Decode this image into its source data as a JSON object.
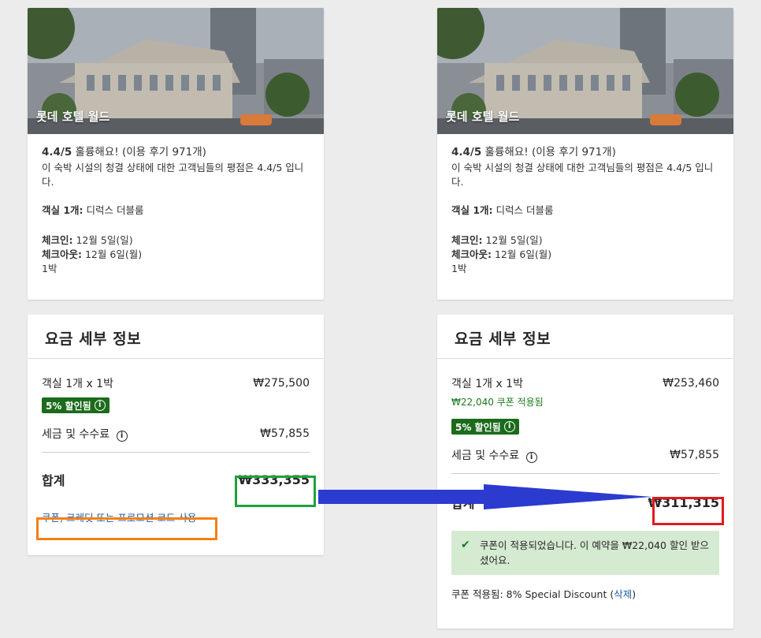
{
  "left": {
    "hotel": {
      "name": "롯데 호텔 월드",
      "rating_score": "4.4/5",
      "rating_word": "훌륭해요!",
      "review_count": "(이용 후기 971개)",
      "clean_text": "이 숙박 시설의 청결 상태에 대한 고객님들의 평점은 4.4/5 입니다.",
      "room_label": "객실 1개:",
      "room_value": "디럭스 더블룸",
      "checkin_label": "체크인:",
      "checkin_value": "12월 5일(일)",
      "checkout_label": "체크아웃:",
      "checkout_value": "12월 6일(월)",
      "nights": "1박"
    },
    "price": {
      "title": "요금 세부 정보",
      "room_line": "객실 1개 x 1박",
      "room_price": "₩275,500",
      "discount_badge": "5% 할인됨",
      "tax_label": "세금 및 수수료",
      "tax_value": "₩57,855",
      "total_label": "합계",
      "total_value": "₩333,355",
      "promo_link": "쿠폰, 크레딧 또는 프로모션 코드 사용"
    }
  },
  "right": {
    "hotel": {
      "name": "롯데 호텔 월드",
      "rating_score": "4.4/5",
      "rating_word": "훌륭해요!",
      "review_count": "(이용 후기 971개)",
      "clean_text": "이 숙박 시설의 청결 상태에 대한 고객님들의 평점은 4.4/5 입니다.",
      "room_label": "객실 1개:",
      "room_value": "디럭스 더블룸",
      "checkin_label": "체크인:",
      "checkin_value": "12월 5일(일)",
      "checkout_label": "체크아웃:",
      "checkout_value": "12월 6일(월)",
      "nights": "1박"
    },
    "price": {
      "title": "요금 세부 정보",
      "room_line": "객실 1개 x 1박",
      "room_price": "₩253,460",
      "coupon_applied": "₩22,040 쿠폰 적용됨",
      "discount_badge": "5% 할인됨",
      "tax_label": "세금 및 수수료",
      "tax_value": "₩57,855",
      "total_label": "합계",
      "total_value": "₩311,315",
      "success_message": "쿠폰이 적용되었습니다. 이 예약을 ₩22,040 할인 받으셨어요.",
      "applied_prefix": "쿠폰 적용됨: 8% Special Discount (",
      "remove_link": "삭제",
      "applied_suffix": ")"
    }
  },
  "colors": {
    "badge_green": "#1b6b1b",
    "highlight_green": "#1fa23a",
    "highlight_orange": "#f57f17",
    "highlight_red": "#e01b1b",
    "arrow_blue": "#2b3bd0",
    "success_bg": "#d5ebd1"
  },
  "icons": {
    "info": "info-circle-icon",
    "check": "checkmark-icon",
    "arrow": "right-arrow-icon"
  }
}
